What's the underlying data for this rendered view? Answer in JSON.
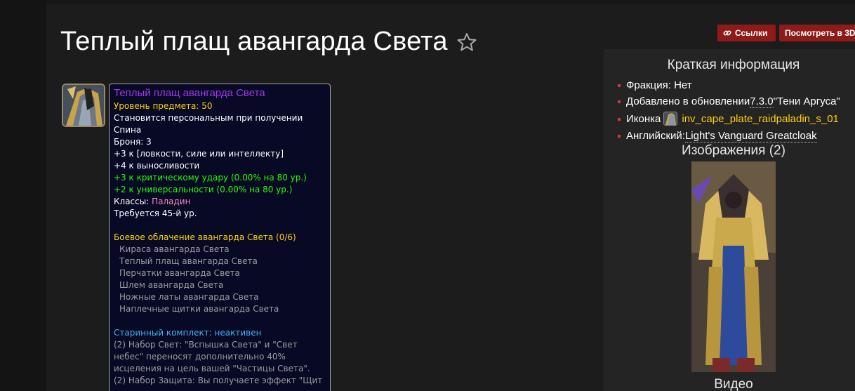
{
  "page": {
    "title": "Теплый плащ авангарда Света"
  },
  "buttons": {
    "links_label": "Ссылки",
    "view3d_label": "Посмотреть в 3D"
  },
  "tooltip": {
    "name": "Теплый плащ авангарда Света",
    "item_level": "Уровень предмета: 50",
    "binds": "Становится персональным при получении",
    "slot": "Спина",
    "armor": "Броня: 3",
    "stat_primary": "+3 к [ловкости, силе или интеллекту]",
    "stat_stamina": "+4 к выносливости",
    "stat_crit": "+3 к критическому удару (0.00% на 80 ур.)",
    "stat_vers": "+2 к универсальности (0.00% на 80 ур.)",
    "classes_label": "Классы: ",
    "classes_value": "Паладин",
    "requires_level": "Требуется 45-й ур.",
    "set_name": "Боевое облачение авангарда Света (0/6)",
    "set_pieces": [
      "Кираса авангарда Света",
      "Теплый плащ авангарда Света",
      "Перчатки авангарда Света",
      "Шлем авангарда Света",
      "Ножные латы авангарда Света",
      "Наплечные щитки авангарда Света"
    ],
    "legacy_set": "Старинный комплект: неактивен",
    "legacy_bonus_lines": [
      "(2) Набор Свет: \"Вспышка Света\" и \"Свет",
      "небес\" переносят дополнительно 40%",
      "исцеления на цель вашей \"Частицы Света\".",
      "(2) Набор Защита: Вы получаете эффект \"Щит"
    ]
  },
  "sidebar": {
    "title": "Краткая информация",
    "faction_label": "Фракция: Нет",
    "added_label": "Добавлено в обновлении ",
    "added_version": "7.3.0",
    "added_name": " \"Тени Аргуса\"",
    "icon_label": "Иконка",
    "icon_name": "inv_cape_plate_raidpaladin_s_01",
    "english_label": "Английский: ",
    "english_name": "Light's Vanguard Greatcloak",
    "images_title": "Изображения (2)",
    "video_title": "Видео"
  },
  "icons": {
    "star": "star-outline-icon",
    "link": "link-icon",
    "item": "cloak-item-icon"
  },
  "colors": {
    "epic": "#a335ee",
    "gold": "#ffd100",
    "green": "#1eff00",
    "paladin": "#f58cba",
    "set_inactive": "#3ab6f6",
    "button_red": "#8e1a1a"
  }
}
